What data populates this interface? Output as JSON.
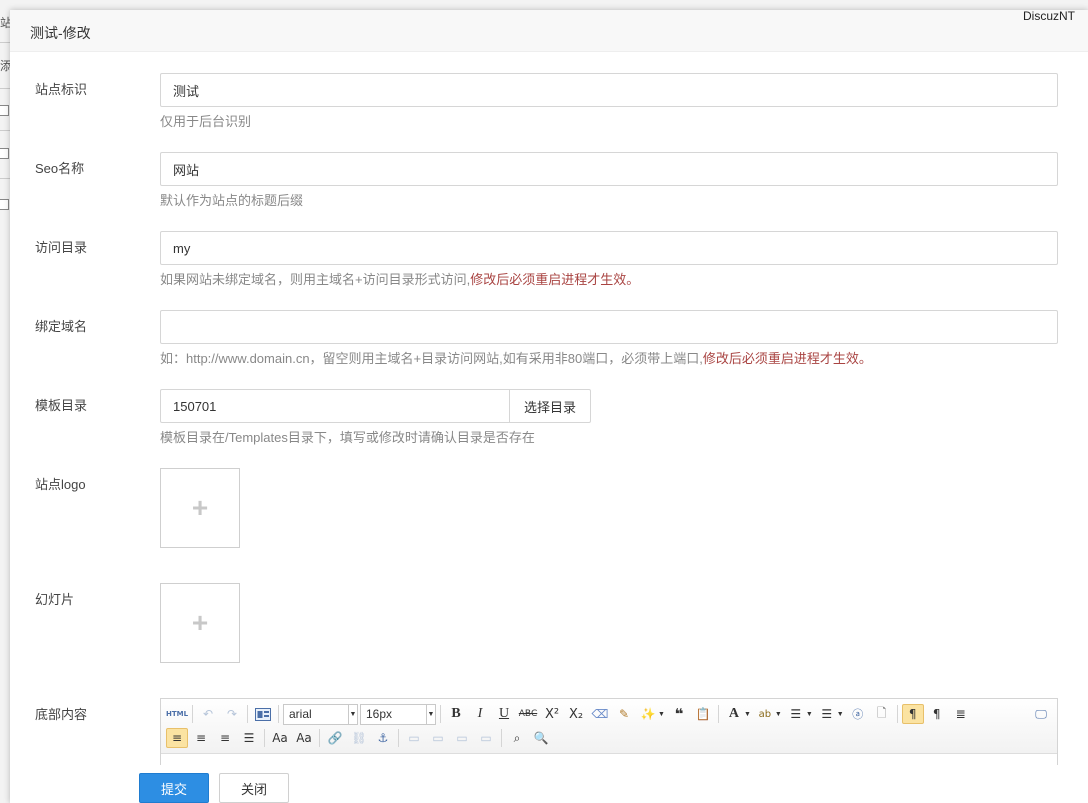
{
  "background": {
    "fragments": [
      "站",
      "添"
    ],
    "brand": "DiscuzNT"
  },
  "dialog": {
    "title": "测试-修改"
  },
  "form": {
    "site_id": {
      "label": "站点标识",
      "value": "测试",
      "help": "仅用于后台识别"
    },
    "seo_name": {
      "label": "Seo名称",
      "value": "网站",
      "help": "默认作为站点的标题后缀"
    },
    "access_dir": {
      "label": "访问目录",
      "value": "my",
      "help": "如果网站未绑定域名，则用主域名+访问目录形式访问,",
      "help_warn": "修改后必须重启进程才生效。"
    },
    "bind_domain": {
      "label": "绑定域名",
      "value": "",
      "help": "如：http://www.domain.cn，留空则用主域名+目录访问网站,如有采用非80端口，必须带上端口,",
      "help_warn": "修改后必须重启进程才生效。"
    },
    "template_dir": {
      "label": "模板目录",
      "value": "150701",
      "button": "选择目录",
      "help": "模板目录在/Templates目录下，填写或修改时请确认目录是否存在"
    },
    "site_logo": {
      "label": "站点logo",
      "plus": "+"
    },
    "slides": {
      "label": "幻灯片",
      "plus": "+"
    },
    "footer_content": {
      "label": "底部内容"
    }
  },
  "editor": {
    "html_label": "HTML",
    "font_family": "arial",
    "font_size": "16px"
  },
  "footer": {
    "submit": "提交",
    "close": "关闭"
  }
}
